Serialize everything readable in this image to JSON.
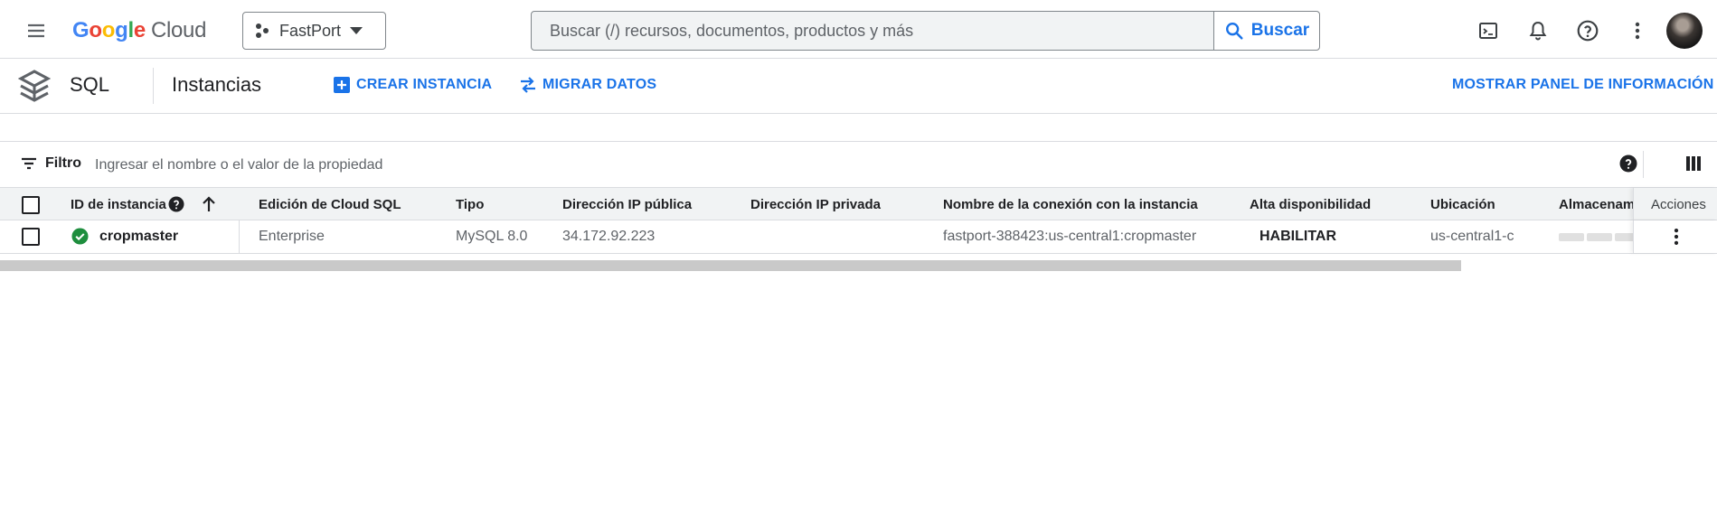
{
  "header": {
    "logo_google": "Google",
    "logo_cloud": "Cloud",
    "project": "FastPort",
    "search_placeholder": "Buscar (/) recursos, documentos, productos y más",
    "search_button": "Buscar"
  },
  "subheader": {
    "product": "SQL",
    "page_title": "Instancias",
    "create_button": "CREAR INSTANCIA",
    "migrate_button": "MIGRAR DATOS",
    "info_panel_button": "MOSTRAR PANEL DE INFORMACIÓN"
  },
  "filter": {
    "label": "Filtro",
    "placeholder": "Ingresar el nombre o el valor de la propiedad"
  },
  "table": {
    "columns": [
      "ID de instancia",
      "Edición de Cloud SQL",
      "Tipo",
      "Dirección IP pública",
      "Dirección IP privada",
      "Nombre de la conexión con la instancia",
      "Alta disponibilidad",
      "Ubicación",
      "Almacenami",
      "Acciones"
    ],
    "rows": [
      {
        "instance_id": "cropmaster",
        "edition": "Enterprise",
        "type": "MySQL 8.0",
        "public_ip": "34.172.92.223",
        "private_ip": "",
        "connection_name": "fastport-388423:us-central1:cropmaster",
        "high_availability": "HABILITAR",
        "location": "us-central1-c",
        "status_color": "#1e8e3e"
      }
    ]
  },
  "colors": {
    "accent": "#1a73e8",
    "status_ok": "#1e8e3e"
  }
}
